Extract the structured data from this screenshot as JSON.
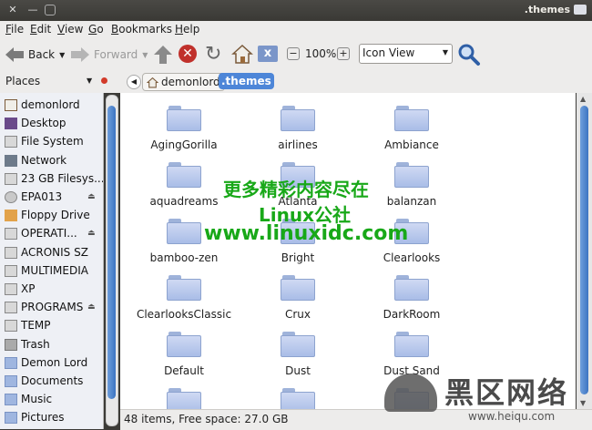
{
  "window": {
    "title": ".themes"
  },
  "menu": [
    {
      "prefix": "",
      "key": "F",
      "rest": "ile"
    },
    {
      "prefix": "",
      "key": "E",
      "rest": "dit"
    },
    {
      "prefix": "",
      "key": "V",
      "rest": "iew"
    },
    {
      "prefix": "",
      "key": "G",
      "rest": "o"
    },
    {
      "prefix": "",
      "key": "B",
      "rest": "ookmarks"
    },
    {
      "prefix": "",
      "key": "H",
      "rest": "elp"
    }
  ],
  "toolbar": {
    "back_label": "Back",
    "forward_label": "Forward",
    "zoom_level": "100%",
    "view_mode": "Icon View"
  },
  "places": {
    "title": "Places",
    "items": [
      {
        "label": "demonlord",
        "icon": "home-icon"
      },
      {
        "label": "Desktop",
        "icon": "desktop-icon"
      },
      {
        "label": "File System",
        "icon": "drive-icon"
      },
      {
        "label": "Network",
        "icon": "network-icon"
      },
      {
        "label": "23 GB Filesys...",
        "icon": "drive-icon"
      },
      {
        "label": "EPA013",
        "icon": "cdrom-icon",
        "eject": "⏏"
      },
      {
        "label": "Floppy Drive",
        "icon": "floppy-icon"
      },
      {
        "label": "OPERATI...",
        "icon": "drive-icon",
        "eject": "⏏"
      },
      {
        "label": "ACRONIS SZ",
        "icon": "drive-icon"
      },
      {
        "label": "MULTIMEDIA",
        "icon": "drive-icon"
      },
      {
        "label": "XP",
        "icon": "drive-icon"
      },
      {
        "label": "PROGRAMS",
        "icon": "drive-icon",
        "eject": "⏏"
      },
      {
        "label": "TEMP",
        "icon": "drive-icon"
      },
      {
        "label": "Trash",
        "icon": "trash-icon"
      },
      {
        "label": "Demon Lord",
        "icon": "folder-icon"
      },
      {
        "label": "Documents",
        "icon": "folder-icon"
      },
      {
        "label": "Music",
        "icon": "folder-icon"
      },
      {
        "label": "Pictures",
        "icon": "folder-icon"
      }
    ]
  },
  "location": {
    "crumbs": [
      "demonlord",
      ".themes"
    ]
  },
  "files": [
    "AgingGorilla",
    "airlines",
    "Ambiance",
    "aquadreams",
    "Atlanta",
    "balanzan",
    "bamboo-zen",
    "Bright",
    "Clearlooks",
    "ClearlooksClassic",
    "Crux",
    "DarkRoom",
    "Default",
    "Dust",
    "Dust Sand",
    "",
    "",
    ""
  ],
  "status": {
    "text": "48 items, Free space: 27.0 GB"
  },
  "watermark": {
    "line1": "更多精彩内容尽在",
    "line2": "Linux公社",
    "line3": "www.linuxidc.com",
    "logo_text": "黑区网络",
    "logo_url": "www.heiqu.com"
  }
}
